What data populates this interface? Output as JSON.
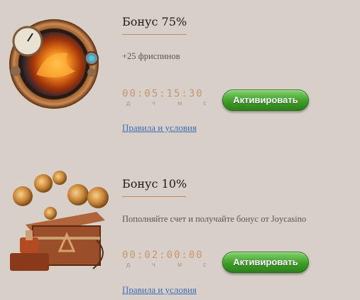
{
  "bonuses": [
    {
      "title": "Бонус 75%",
      "description": "+25 фриспинов",
      "timer": "00:05:15:30",
      "timer_units": [
        "д",
        "ч",
        "м",
        "с"
      ],
      "activate_label": "Активировать",
      "terms_label": "Правила и условия",
      "image_icon": "steampunk-dragon-porthole-icon"
    },
    {
      "title": "Бонус 10%",
      "description": "Пополняйте счет и получайте бонус от Joycasino",
      "timer": "00:02:00:00",
      "timer_units": [
        "д",
        "ч",
        "м",
        "с"
      ],
      "activate_label": "Активировать",
      "terms_label": "Правила и условия",
      "image_icon": "treasure-chest-coins-icon"
    }
  ],
  "colors": {
    "background": "#d9cfc9",
    "button_green": "#3f9e28",
    "link_blue": "#3f6cb6",
    "timer_copper": "#c39771"
  }
}
